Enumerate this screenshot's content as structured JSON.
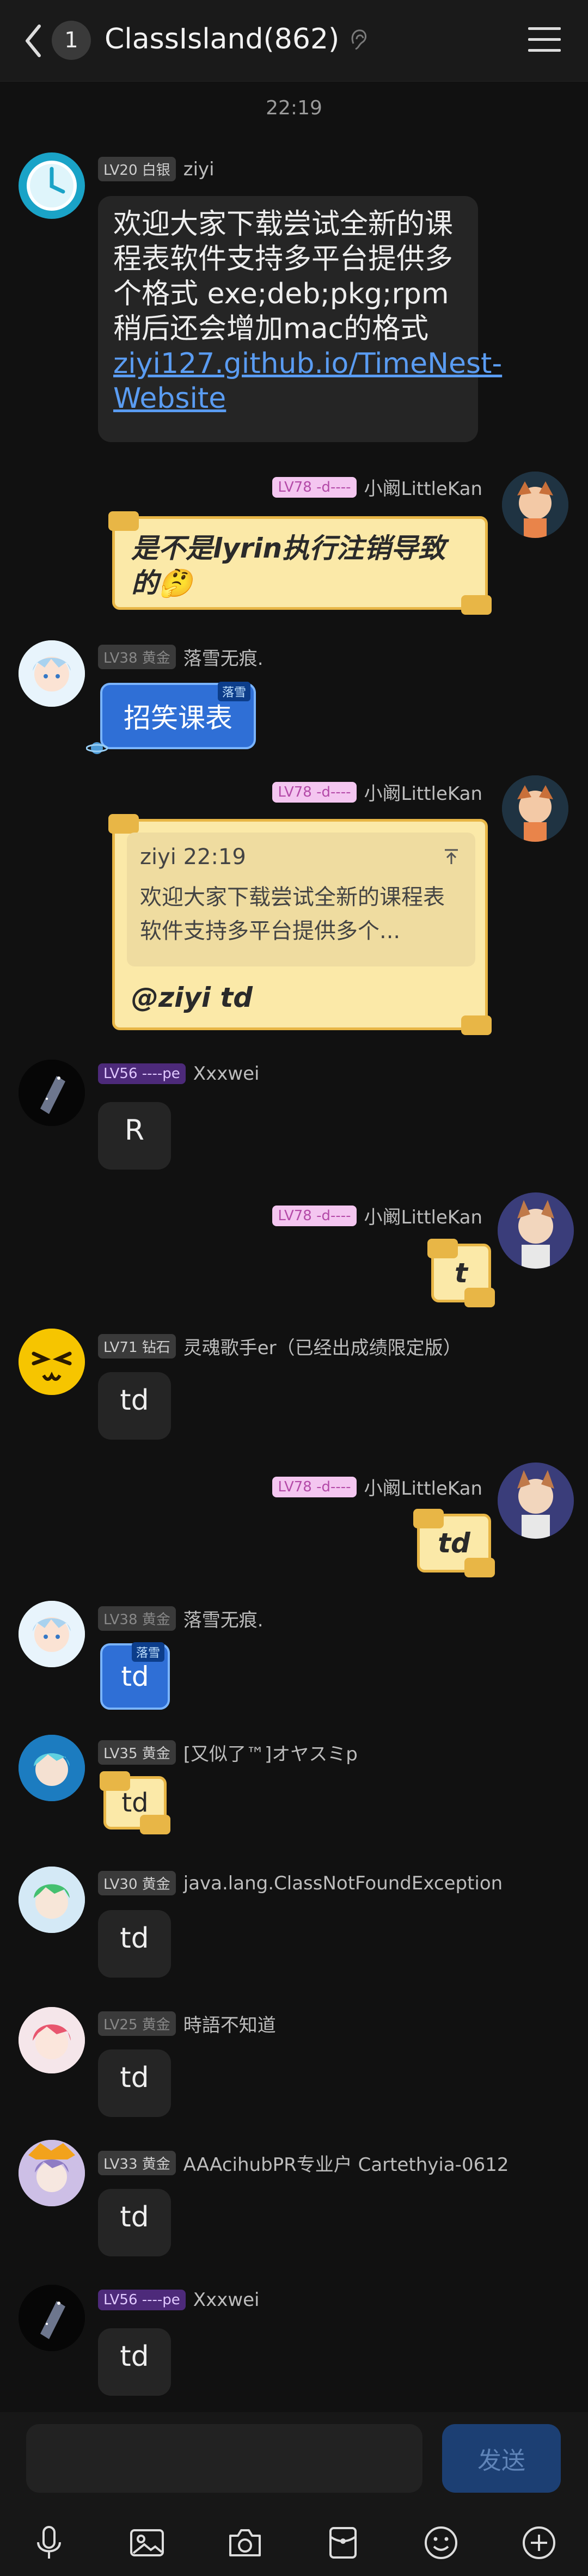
{
  "header": {
    "unread_count": "1",
    "title": "ClassIsland(862)"
  },
  "timestamp": "22:19",
  "messages": [
    {
      "level": "LV20 白银",
      "name": "ziyi",
      "text": "欢迎大家下载尝试全新的课程表软件支持多平台提供多个格式 exe;deb;pkg;rpm稍后还会增加mac的格式",
      "link": "ziyi127.github.io/TimeNest-Website"
    },
    {
      "level": "LV78 -d----",
      "name": "小阚LittleKan",
      "text": "是不是lyrin执行注销导致的🤔"
    },
    {
      "level": "LV38 黄金",
      "name": "落雪无痕.",
      "text": "招笑课表",
      "tag": "落雪"
    },
    {
      "level": "LV78 -d----",
      "name": "小阚LittleKan",
      "quote_header": "ziyi 22:19",
      "quote_text": "欢迎大家下载尝试全新的课程表软件支持多平台提供多个...",
      "text": "@ziyi td"
    },
    {
      "level": "LV56 ----pe",
      "name": "Xxxwei",
      "text": "R"
    },
    {
      "level": "LV78 -d----",
      "name": "小阚LittleKan",
      "text": "t"
    },
    {
      "level": "LV71 钻石",
      "name": "灵魂歌手er（已经出成绩限定版）",
      "text": "td"
    },
    {
      "level": "LV78 -d----",
      "name": "小阚LittleKan",
      "text": "td"
    },
    {
      "level": "LV38 黄金",
      "name": "落雪无痕.",
      "text": "td",
      "tag": "落雪"
    },
    {
      "level": "LV35 黄金",
      "name": "[又似了™]オヤスミp",
      "text": "td"
    },
    {
      "level": "LV30 黄金",
      "name": "java.lang.ClassNotFoundException",
      "text": "td"
    },
    {
      "level": "LV25 黄金",
      "name": "時語不知道",
      "text": "td"
    },
    {
      "level": "LV33 黄金",
      "name": "AAAcihubPR专业户 Cartethyia-0612",
      "text": "td"
    },
    {
      "level": "LV56 ----pe",
      "name": "Xxxwei",
      "text": "td"
    }
  ],
  "composer": {
    "send_label": "发送"
  },
  "colors": {
    "background": "#111111",
    "bubble": "#252525",
    "link": "#5a9cf2",
    "paper": "#fbe9a8",
    "send": "#1c3f73"
  }
}
